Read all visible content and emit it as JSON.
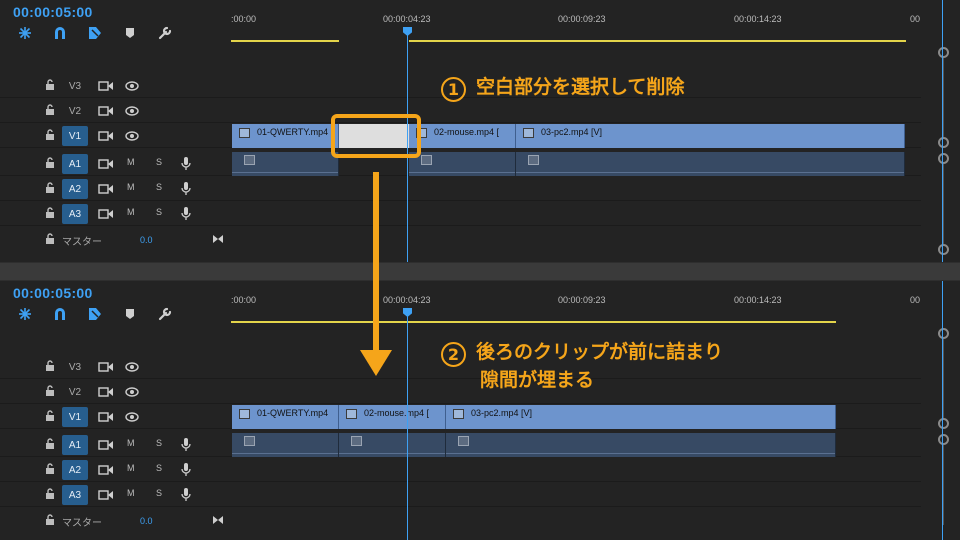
{
  "top": {
    "timecode": "00:00:05:00",
    "ruler_ticks": [
      ":00:00",
      "00:00:04:23",
      "00:00:09:23",
      "00:00:14:23",
      "00"
    ],
    "tracks": {
      "v3": "V3",
      "v2": "V2",
      "v1": "V1",
      "a1": "A1",
      "a2": "A2",
      "a3": "A3"
    },
    "mute_label": "M",
    "solo_label": "S",
    "master_label": "マスター",
    "master_value": "0.0",
    "clips": [
      "01-QWERTY.mp4",
      "02-mouse.mp4 [",
      "03-pc2.mp4 [V]"
    ]
  },
  "bottom": {
    "timecode": "00:00:05:00",
    "ruler_ticks": [
      ":00:00",
      "00:00:04:23",
      "00:00:09:23",
      "00:00:14:23",
      "00"
    ],
    "tracks": {
      "v3": "V3",
      "v2": "V2",
      "v1": "V1",
      "a1": "A1",
      "a2": "A2",
      "a3": "A3"
    },
    "mute_label": "M",
    "solo_label": "S",
    "master_label": "マスター",
    "master_value": "0.0",
    "clips": [
      "01-QWERTY.mp4",
      "02-mouse.mp4 [",
      "03-pc2.mp4 [V]"
    ]
  },
  "annotations": {
    "step1_num": "1",
    "step1_text": "空白部分を選択して削除",
    "step2_num": "2",
    "step2_line1": "後ろのクリップが前に詰まり",
    "step2_line2": "隙間が埋まる"
  },
  "colors": {
    "accent_orange": "#f5a51a",
    "timecode_blue": "#3ea1f4",
    "video_clip": "#6d94cd",
    "audio_clip": "#374a64",
    "work_area": "#e3d44a"
  },
  "icons": [
    "ripple-snap-icon",
    "magnet-icon",
    "linked-selection-icon",
    "marker-icon",
    "wrench-icon",
    "lock-icon",
    "sync-icon",
    "eye-icon",
    "mic-icon"
  ]
}
